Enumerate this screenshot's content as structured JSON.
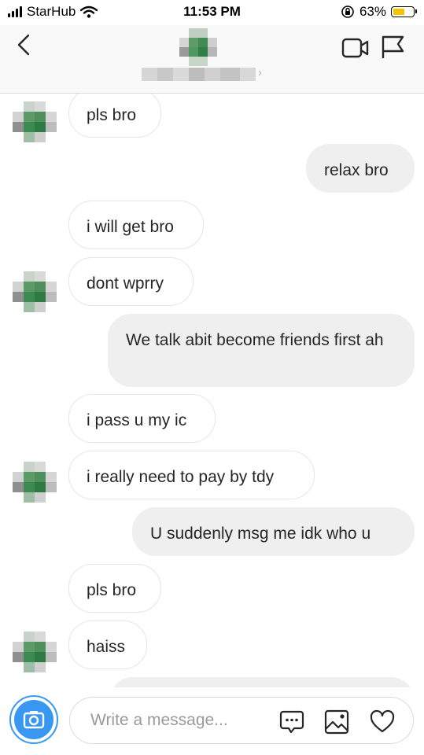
{
  "status_bar": {
    "carrier": "StarHub",
    "time": "11:53 PM",
    "battery_percent": "63%",
    "battery_level": 0.63
  },
  "header": {
    "back_icon": "chevron-left-icon",
    "video_icon": "video-call-icon",
    "flag_icon": "flag-icon",
    "name_chevron": "›"
  },
  "messages": [
    {
      "side": "in",
      "text": "pls bro",
      "avatar": true
    },
    {
      "side": "out",
      "text": "relax bro"
    },
    {
      "side": "in",
      "text": "i will get bro"
    },
    {
      "side": "in",
      "text": "dont wprry",
      "avatar": true
    },
    {
      "side": "out",
      "text": "We talk abit become friends first ah"
    },
    {
      "side": "in",
      "text": "i pass u my ic"
    },
    {
      "side": "in",
      "text": "i really need to pay by tdy",
      "avatar": true
    },
    {
      "side": "out",
      "text": "U suddenly msg me idk who u"
    },
    {
      "side": "in",
      "text": "pls bro"
    },
    {
      "side": "in",
      "text": "haiss",
      "avatar": true
    }
  ],
  "composer": {
    "placeholder": "Write a message...",
    "camera_icon": "camera-icon",
    "chat_icon": "chat-bubble-icon",
    "gallery_icon": "image-icon",
    "like_icon": "heart-icon"
  }
}
